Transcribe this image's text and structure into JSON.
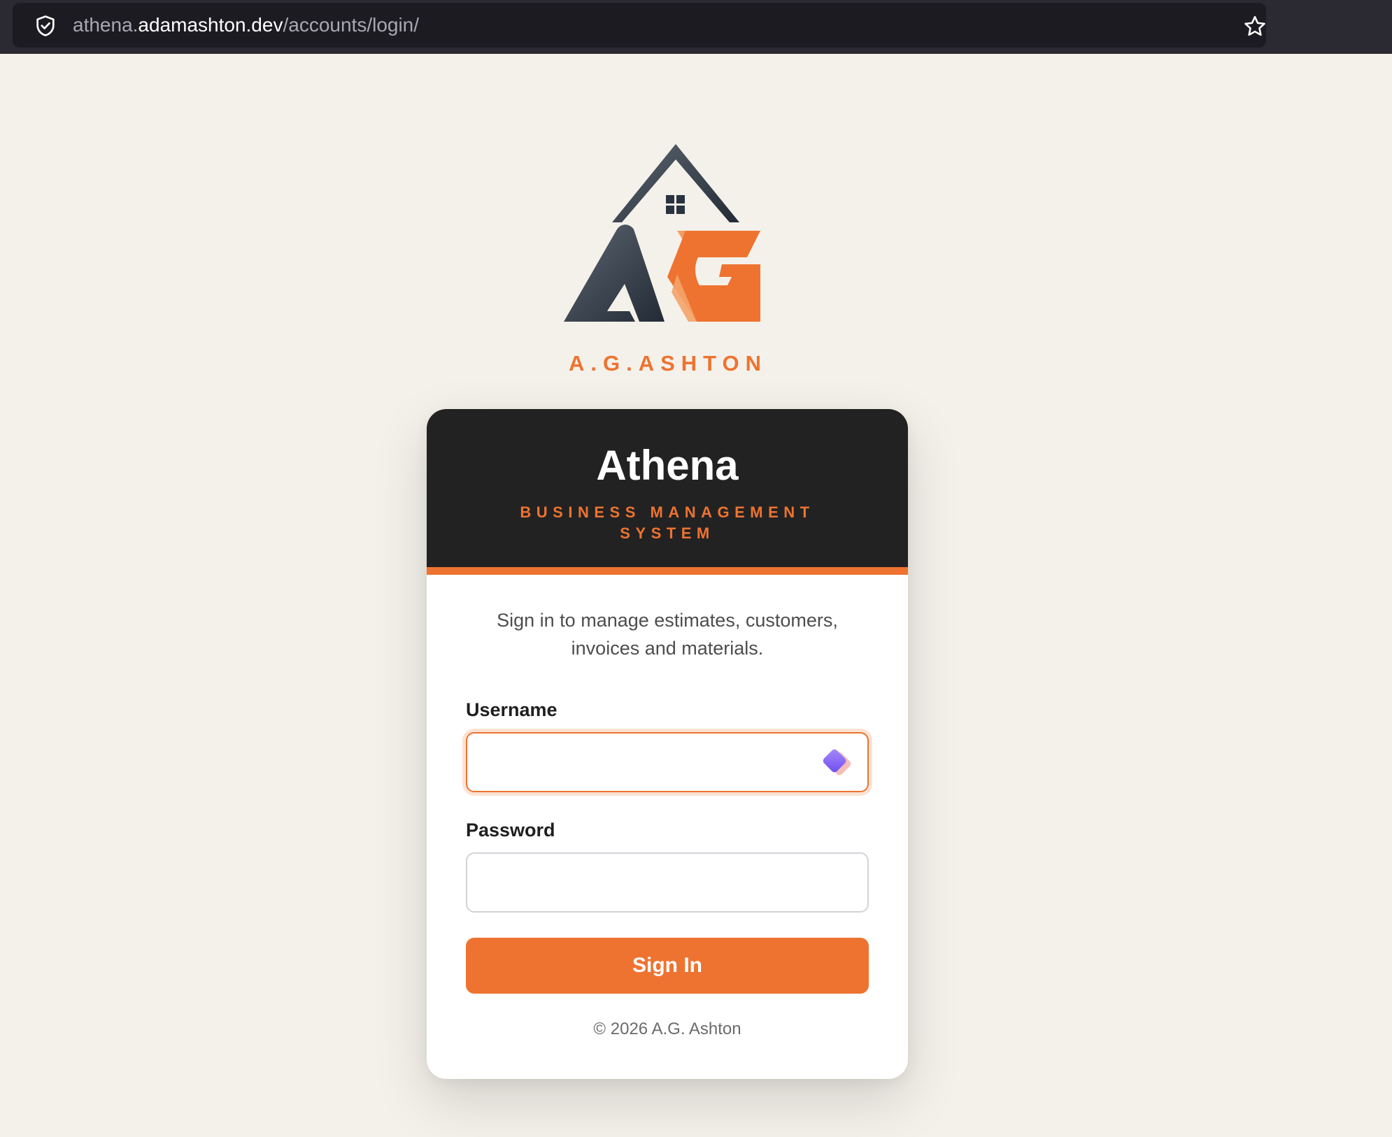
{
  "browser": {
    "url_prefix": "athena.",
    "url_host": "adamashton.dev",
    "url_path": "/accounts/login/",
    "icons": [
      "shield-check-icon",
      "bookmark-star-icon"
    ]
  },
  "logo": {
    "letters": "AG",
    "brand": "A.G.ASHTON"
  },
  "card": {
    "title": "Athena",
    "subtitle": "BUSINESS MANAGEMENT SYSTEM",
    "intro": "Sign in to manage estimates, customers, invoices and materials.",
    "username_label": "Username",
    "username_value": "",
    "password_label": "Password",
    "password_value": "",
    "submit_label": "Sign In",
    "footer": "© 2026 A.G. Ashton"
  },
  "colors": {
    "accent": "#ee7330",
    "dark": "#222222",
    "page_background": "#f4f1ea",
    "logo_dark": "#2a3340"
  }
}
